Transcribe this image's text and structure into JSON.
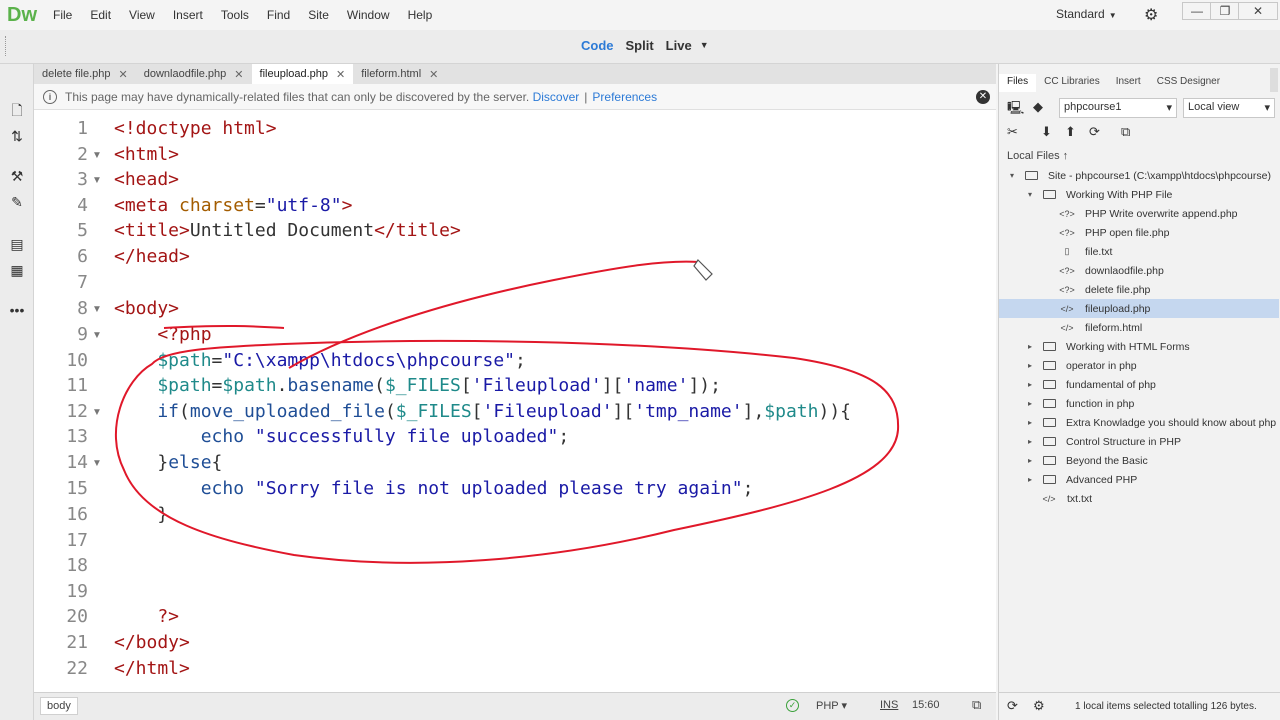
{
  "app": {
    "logo": "Dw",
    "workspace": "Standard"
  },
  "menu": [
    "File",
    "Edit",
    "View",
    "Insert",
    "Tools",
    "Find",
    "Site",
    "Window",
    "Help"
  ],
  "view_buttons": {
    "code": "Code",
    "split": "Split",
    "live": "Live"
  },
  "tabs": [
    {
      "label": "delete file.php"
    },
    {
      "label": "downlaodfile.php"
    },
    {
      "label": "fileupload.php"
    },
    {
      "label": "fileform.html"
    }
  ],
  "infobar": {
    "message": "This page may have dynamically-related files that can only be discovered by the server.",
    "discover": "Discover",
    "separator": "|",
    "preferences": "Preferences"
  },
  "code": {
    "line_numbers": [
      "1",
      "2",
      "3",
      "4",
      "5",
      "6",
      "7",
      "8",
      "9",
      "10",
      "11",
      "12",
      "13",
      "14",
      "15",
      "16",
      "17",
      "18",
      "19",
      "20",
      "21",
      "22"
    ]
  },
  "status": {
    "breadcrumb": "body",
    "language": "PHP",
    "ins": "INS",
    "position": "15:60"
  },
  "panel": {
    "tabs": [
      "Files",
      "CC Libraries",
      "Insert",
      "CSS Designer"
    ],
    "site": "phpcourse1",
    "view": "Local view",
    "local_files": "Local Files",
    "tree": [
      {
        "label": "Site - phpcourse1 (C:\\xampp\\htdocs\\phpcourse)"
      },
      {
        "label": "Working With PHP File"
      },
      {
        "label": "PHP Write overwrite append.php"
      },
      {
        "label": "PHP open file.php"
      },
      {
        "label": "file.txt"
      },
      {
        "label": "downlaodfile.php"
      },
      {
        "label": "delete file.php"
      },
      {
        "label": "fileupload.php"
      },
      {
        "label": "fileform.html"
      },
      {
        "label": "Working with HTML Forms"
      },
      {
        "label": "operator in php"
      },
      {
        "label": "fundamental of php"
      },
      {
        "label": "function in php"
      },
      {
        "label": "Extra Knowladge you should know about php"
      },
      {
        "label": "Control Structure in PHP"
      },
      {
        "label": "Beyond the Basic"
      },
      {
        "label": "Advanced PHP"
      },
      {
        "label": "txt.txt"
      }
    ],
    "status_message": "1 local items selected totalling 126 bytes."
  },
  "colors": {
    "accent": "#2c7ad6",
    "logo": "#5bb24b",
    "annotation": "#e0182a",
    "selection": "#c5d7ef"
  }
}
